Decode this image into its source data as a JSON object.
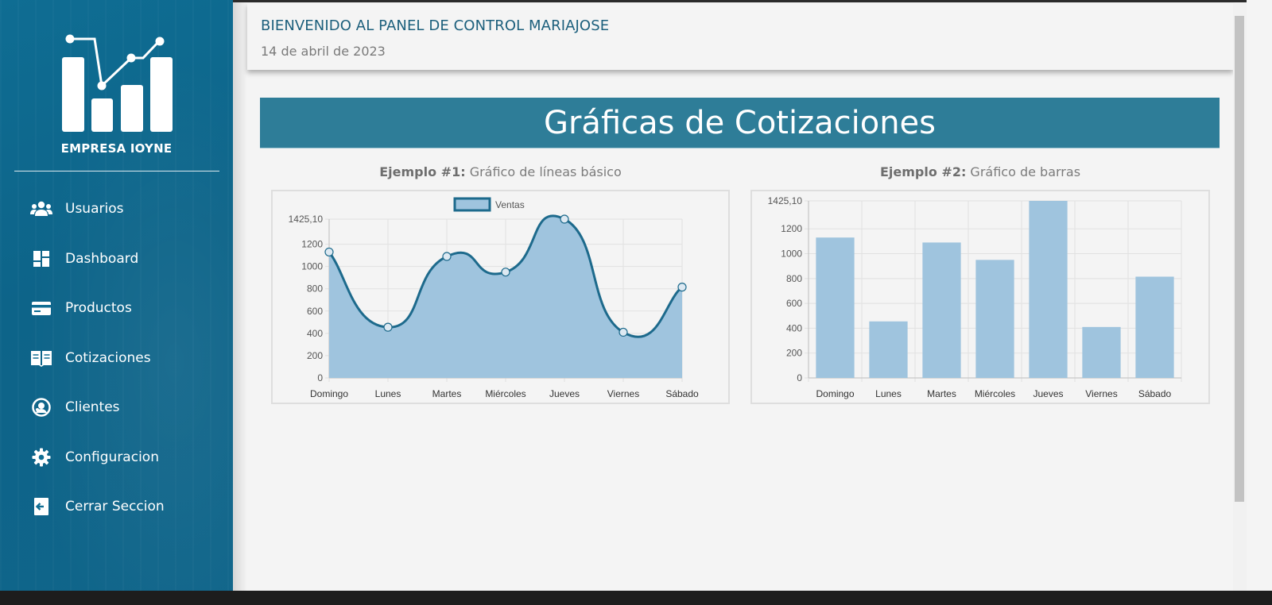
{
  "sidebar": {
    "company": "EMPRESA IOYNE",
    "items": [
      {
        "label": "Usuarios",
        "icon": "users-icon"
      },
      {
        "label": "Dashboard",
        "icon": "dashboard-icon"
      },
      {
        "label": "Productos",
        "icon": "credit-card-icon"
      },
      {
        "label": "Cotizaciones",
        "icon": "open-book-icon"
      },
      {
        "label": "Clientes",
        "icon": "user-circle-icon"
      },
      {
        "label": "Configuracion",
        "icon": "gear-icon"
      },
      {
        "label": "Cerrar Seccion",
        "icon": "sign-out-icon"
      }
    ]
  },
  "header": {
    "welcome": "BIENVENIDO AL PANEL DE CONTROL MARIAJOSE",
    "date": "14 de abril de 2023"
  },
  "main": {
    "banner": "Gráficas de Cotizaciones",
    "chart1_title_bold": "Ejemplo #1:",
    "chart1_title_rest": " Gráfico de líneas básico",
    "chart2_title_bold": "Ejemplo #2:",
    "chart2_title_rest": " Gráfico de barras"
  },
  "colors": {
    "sidebar": "#0f6d93",
    "banner": "#2e7d98",
    "line": "#1d6a8c",
    "fill": "#9fc4de"
  },
  "chart_data": [
    {
      "type": "area",
      "categories": [
        "Domingo",
        "Lunes",
        "Martes",
        "Miércoles",
        "Jueves",
        "Viernes",
        "Sábado"
      ],
      "series": [
        {
          "name": "Ventas",
          "values": [
            1130,
            455,
            1090,
            950,
            1425.1,
            410,
            815
          ]
        }
      ],
      "ylim": [
        0,
        1425.1
      ],
      "yticks": [
        "1425,10",
        "1200",
        "1000",
        "800",
        "600",
        "400",
        "200",
        "0"
      ],
      "legend": "top",
      "grid": true
    },
    {
      "type": "bar",
      "categories": [
        "Domingo",
        "Lunes",
        "Martes",
        "Miércoles",
        "Jueves",
        "Viernes",
        "Sábado"
      ],
      "series": [
        {
          "values": [
            1130,
            455,
            1090,
            950,
            1425.1,
            410,
            815
          ]
        }
      ],
      "ylim": [
        0,
        1425.1
      ],
      "yticks": [
        "1425,10",
        "1200",
        "1000",
        "800",
        "600",
        "400",
        "200",
        "0"
      ],
      "grid": true
    }
  ]
}
